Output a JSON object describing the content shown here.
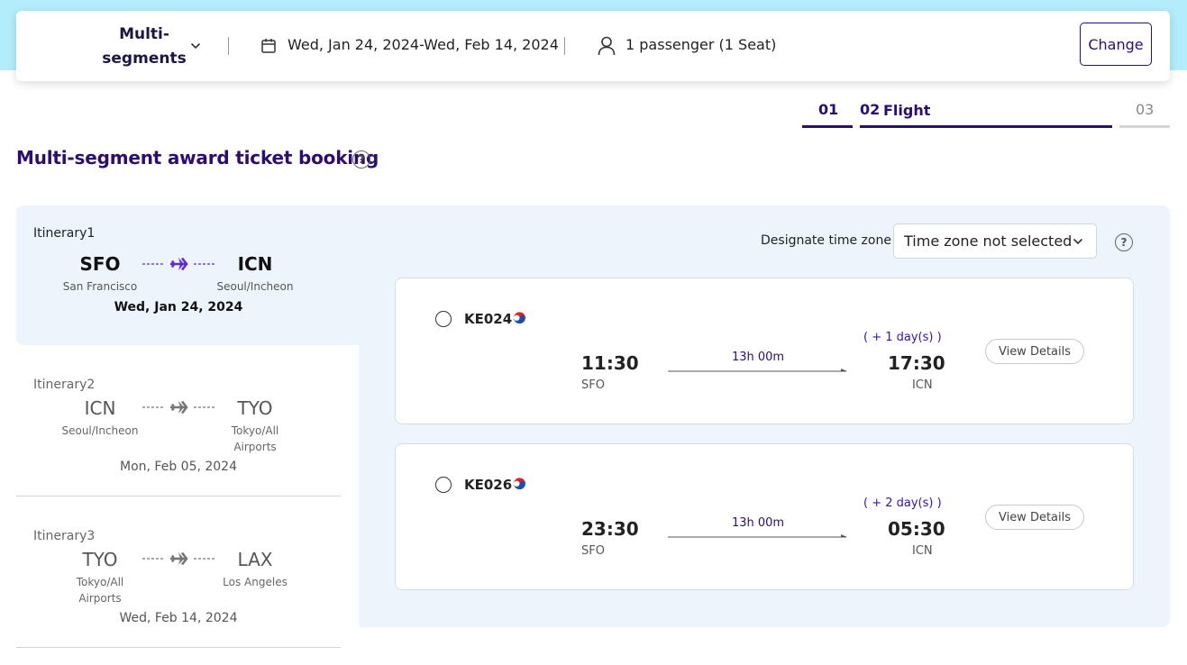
{
  "search": {
    "trip_type_line1": "Multi-",
    "trip_type_line2": "segments",
    "dates": "Wed, Jan 24, 2024-Wed, Feb 14, 2024",
    "passengers": "1 passenger (1 Seat)",
    "change_label": "Change",
    "icons": [
      "chevron-down-icon",
      "calendar-icon",
      "person-icon"
    ]
  },
  "steps": [
    {
      "num": "01",
      "label": ""
    },
    {
      "num": "02",
      "label": "Flight"
    },
    {
      "num": "03",
      "label": ""
    }
  ],
  "page": {
    "title": "Multi-segment award ticket booking",
    "help_glyph": "?"
  },
  "itineraries": [
    {
      "name": "Itinerary1",
      "from_code": "SFO",
      "from_city": "San Francisco",
      "to_code": "ICN",
      "to_city": "Seoul/Incheon",
      "date": "Wed, Jan 24, 2024",
      "active": true
    },
    {
      "name": "Itinerary2",
      "from_code": "ICN",
      "from_city": "Seoul/Incheon",
      "to_code": "TYO",
      "to_city": "Tokyo/All Airports",
      "date": "Mon, Feb 05, 2024",
      "active": false
    },
    {
      "name": "Itinerary3",
      "from_code": "TYO",
      "from_city": "Tokyo/All Airports",
      "to_code": "LAX",
      "to_city": "Los Angeles",
      "date": "Wed, Feb 14, 2024",
      "active": false
    }
  ],
  "timezone": {
    "label": "Designate time zone",
    "value": "Time zone not selected"
  },
  "flights": [
    {
      "number": "KE024",
      "plus_days": "( + 1 day(s) )",
      "dep_time": "11:30",
      "dep_code": "SFO",
      "duration": "13h 00m",
      "arr_time": "17:30",
      "arr_code": "ICN",
      "details_label": "View Details"
    },
    {
      "number": "KE026",
      "plus_days": "( + 2 day(s) )",
      "dep_time": "23:30",
      "dep_code": "SFO",
      "duration": "13h 00m",
      "arr_time": "05:30",
      "arr_code": "ICN",
      "details_label": "View Details"
    }
  ],
  "colors": {
    "brand": "#2d0e6e",
    "accent_purple": "#5b2bd6",
    "panel_bg": "#eef4fc",
    "top_band": "#b3ecfa"
  }
}
